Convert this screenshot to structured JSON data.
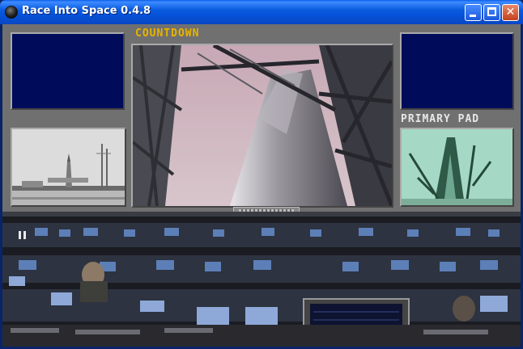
{
  "window": {
    "title": "Race Into Space 0.4.8",
    "icon": "app-globe-icon",
    "controls": {
      "minimize": "minimize-icon",
      "maximize": "maximize-icon",
      "close": "close-icon",
      "close_glyph": "✕"
    }
  },
  "game": {
    "countdown_label": "COUNTDOWN",
    "pad_label": "PRIMARY PAD",
    "colors": {
      "countdown": "#e8b400",
      "pad_label": "#e6e6e6",
      "monitor": "#000c5a",
      "frame": "#707070"
    }
  }
}
